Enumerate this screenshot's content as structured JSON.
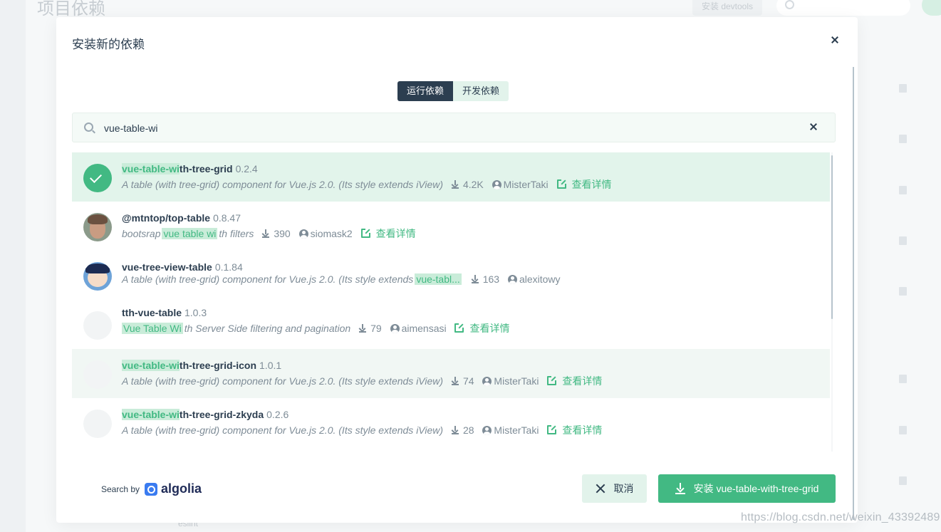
{
  "background": {
    "page_title": "项目依赖",
    "devtools_button": "安装 devtools",
    "bottom_text": "eslint",
    "watermark": "https://blog.csdn.net/weixin_43392489"
  },
  "modal": {
    "title": "安装新的依赖",
    "tabs": [
      {
        "label": "运行依赖",
        "active": true
      },
      {
        "label": "开发依赖",
        "active": false
      }
    ],
    "search": {
      "value": "vue-table-wi",
      "placeholder": ""
    },
    "results": [
      {
        "name_highlight": "vue-table-wi",
        "name_rest": "th-tree-grid",
        "version": "0.2.4",
        "desc_pre": "",
        "desc_highlight": "",
        "desc_post": "A table (with tree-grid) component for Vue.js 2.0. (Its style extends iView)",
        "downloads": "4.2K",
        "author": "MisterTaki",
        "details": "查看详情",
        "selected": true
      },
      {
        "name_highlight": "",
        "name_rest": "@mtntop/top-table",
        "version": "0.8.47",
        "desc_pre": "bootsrap",
        "desc_highlight": "vue table wi",
        "desc_post": "th filters",
        "downloads": "390",
        "author": "siomask2",
        "details": "查看详情"
      },
      {
        "name_highlight": "",
        "name_rest": "vue-tree-view-table",
        "version": "0.1.84",
        "desc_pre": "A table (with tree-grid) component for Vue.js 2.0. (Its style extends",
        "desc_highlight": "vue-tabl...",
        "desc_post": "",
        "downloads": "163",
        "author": "alexitowy",
        "details": ""
      },
      {
        "name_highlight": "",
        "name_rest": "tth-vue-table",
        "version": "1.0.3",
        "desc_pre": "",
        "desc_highlight": "Vue Table Wi",
        "desc_post": "th Server Side filtering and pagination",
        "downloads": "79",
        "author": "aimensasi",
        "details": "查看详情"
      },
      {
        "name_highlight": "vue-table-wi",
        "name_rest": "th-tree-grid-icon",
        "version": "1.0.1",
        "desc_pre": "",
        "desc_highlight": "",
        "desc_post": "A table (with tree-grid) component for Vue.js 2.0. (Its style extends iView)",
        "downloads": "74",
        "author": "MisterTaki",
        "details": "查看详情",
        "hover": true
      },
      {
        "name_highlight": "vue-table-wi",
        "name_rest": "th-tree-grid-zkyda",
        "version": "0.2.6",
        "desc_pre": "",
        "desc_highlight": "",
        "desc_post": "A table (with tree-grid) component for Vue.js 2.0. (Its style extends iView)",
        "downloads": "28",
        "author": "MisterTaki",
        "details": "查看详情"
      }
    ],
    "footer": {
      "search_by": "Search by",
      "algolia": "algolia",
      "cancel_label": "取消",
      "install_label": "安装 vue-table-with-tree-grid"
    }
  },
  "colors": {
    "accent": "#42b983",
    "dark": "#2c3e50",
    "highlight_bg": "#c9ecd9"
  },
  "icons": [
    "close-icon",
    "search-icon",
    "check-icon",
    "download-icon",
    "user-icon",
    "external-link-icon",
    "algolia-logo"
  ]
}
